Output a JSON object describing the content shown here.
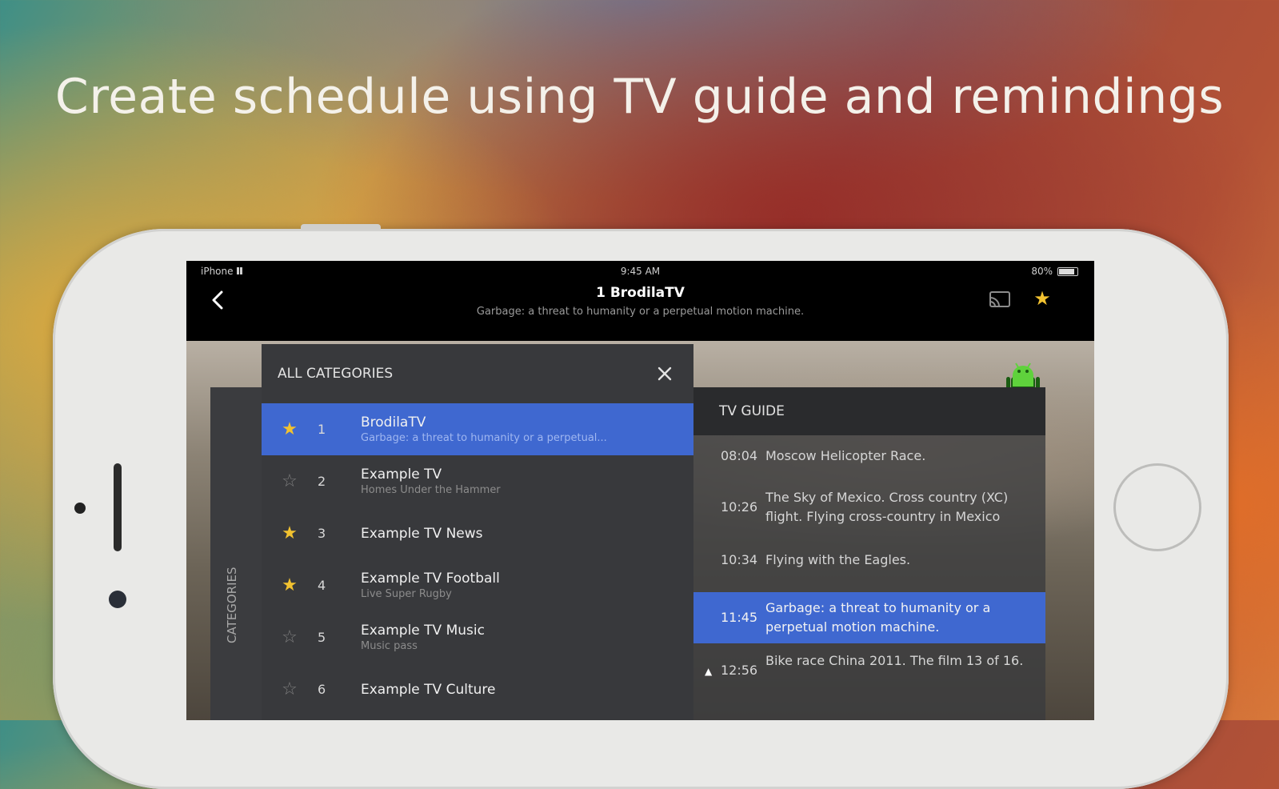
{
  "headline": "Create schedule using TV guide and remindings",
  "status_bar": {
    "carrier": "iPhone",
    "time": "9:45 AM",
    "battery": "80%"
  },
  "nav": {
    "title": "1  BrodilaTV",
    "subtitle": "Garbage: a threat to humanity or a perpetual motion machine."
  },
  "categories": {
    "header": "ALL CATEGORIES",
    "rail_label": "CATEGORIES",
    "items": [
      {
        "num": "1",
        "name": "BrodilaTV",
        "desc": "Garbage: a threat to humanity or a perpetual...",
        "favorite": true,
        "active": true
      },
      {
        "num": "2",
        "name": "Example TV",
        "desc": "Homes Under the Hammer",
        "favorite": false,
        "active": false
      },
      {
        "num": "3",
        "name": "Example TV News",
        "desc": "",
        "favorite": true,
        "active": false
      },
      {
        "num": "4",
        "name": "Example TV Football",
        "desc": "Live Super Rugby",
        "favorite": true,
        "active": false
      },
      {
        "num": "5",
        "name": "Example TV Music",
        "desc": "Music pass",
        "favorite": false,
        "active": false
      },
      {
        "num": "6",
        "name": "Example TV Culture",
        "desc": "",
        "favorite": false,
        "active": false
      }
    ]
  },
  "guide": {
    "header": "TV GUIDE",
    "items": [
      {
        "time": "08:04",
        "program": "Moscow Helicopter Race.",
        "active": false,
        "reminder": false
      },
      {
        "time": "10:26",
        "program": "The Sky of Mexico. Cross country (XC) flight. Flying cross-country in Mexico",
        "active": false,
        "reminder": false
      },
      {
        "time": "10:34",
        "program": "Flying with the Eagles.",
        "active": false,
        "reminder": false
      },
      {
        "time": "11:45",
        "program": "Garbage: a threat to humanity or a perpetual motion machine.",
        "active": true,
        "reminder": false
      },
      {
        "time": "12:56",
        "program": "Bike race China 2011. The film 13 of 16.",
        "active": false,
        "reminder": true
      }
    ]
  },
  "colors": {
    "accent": "#3f68d0",
    "star": "#f2c230",
    "panel": "#38393c"
  }
}
